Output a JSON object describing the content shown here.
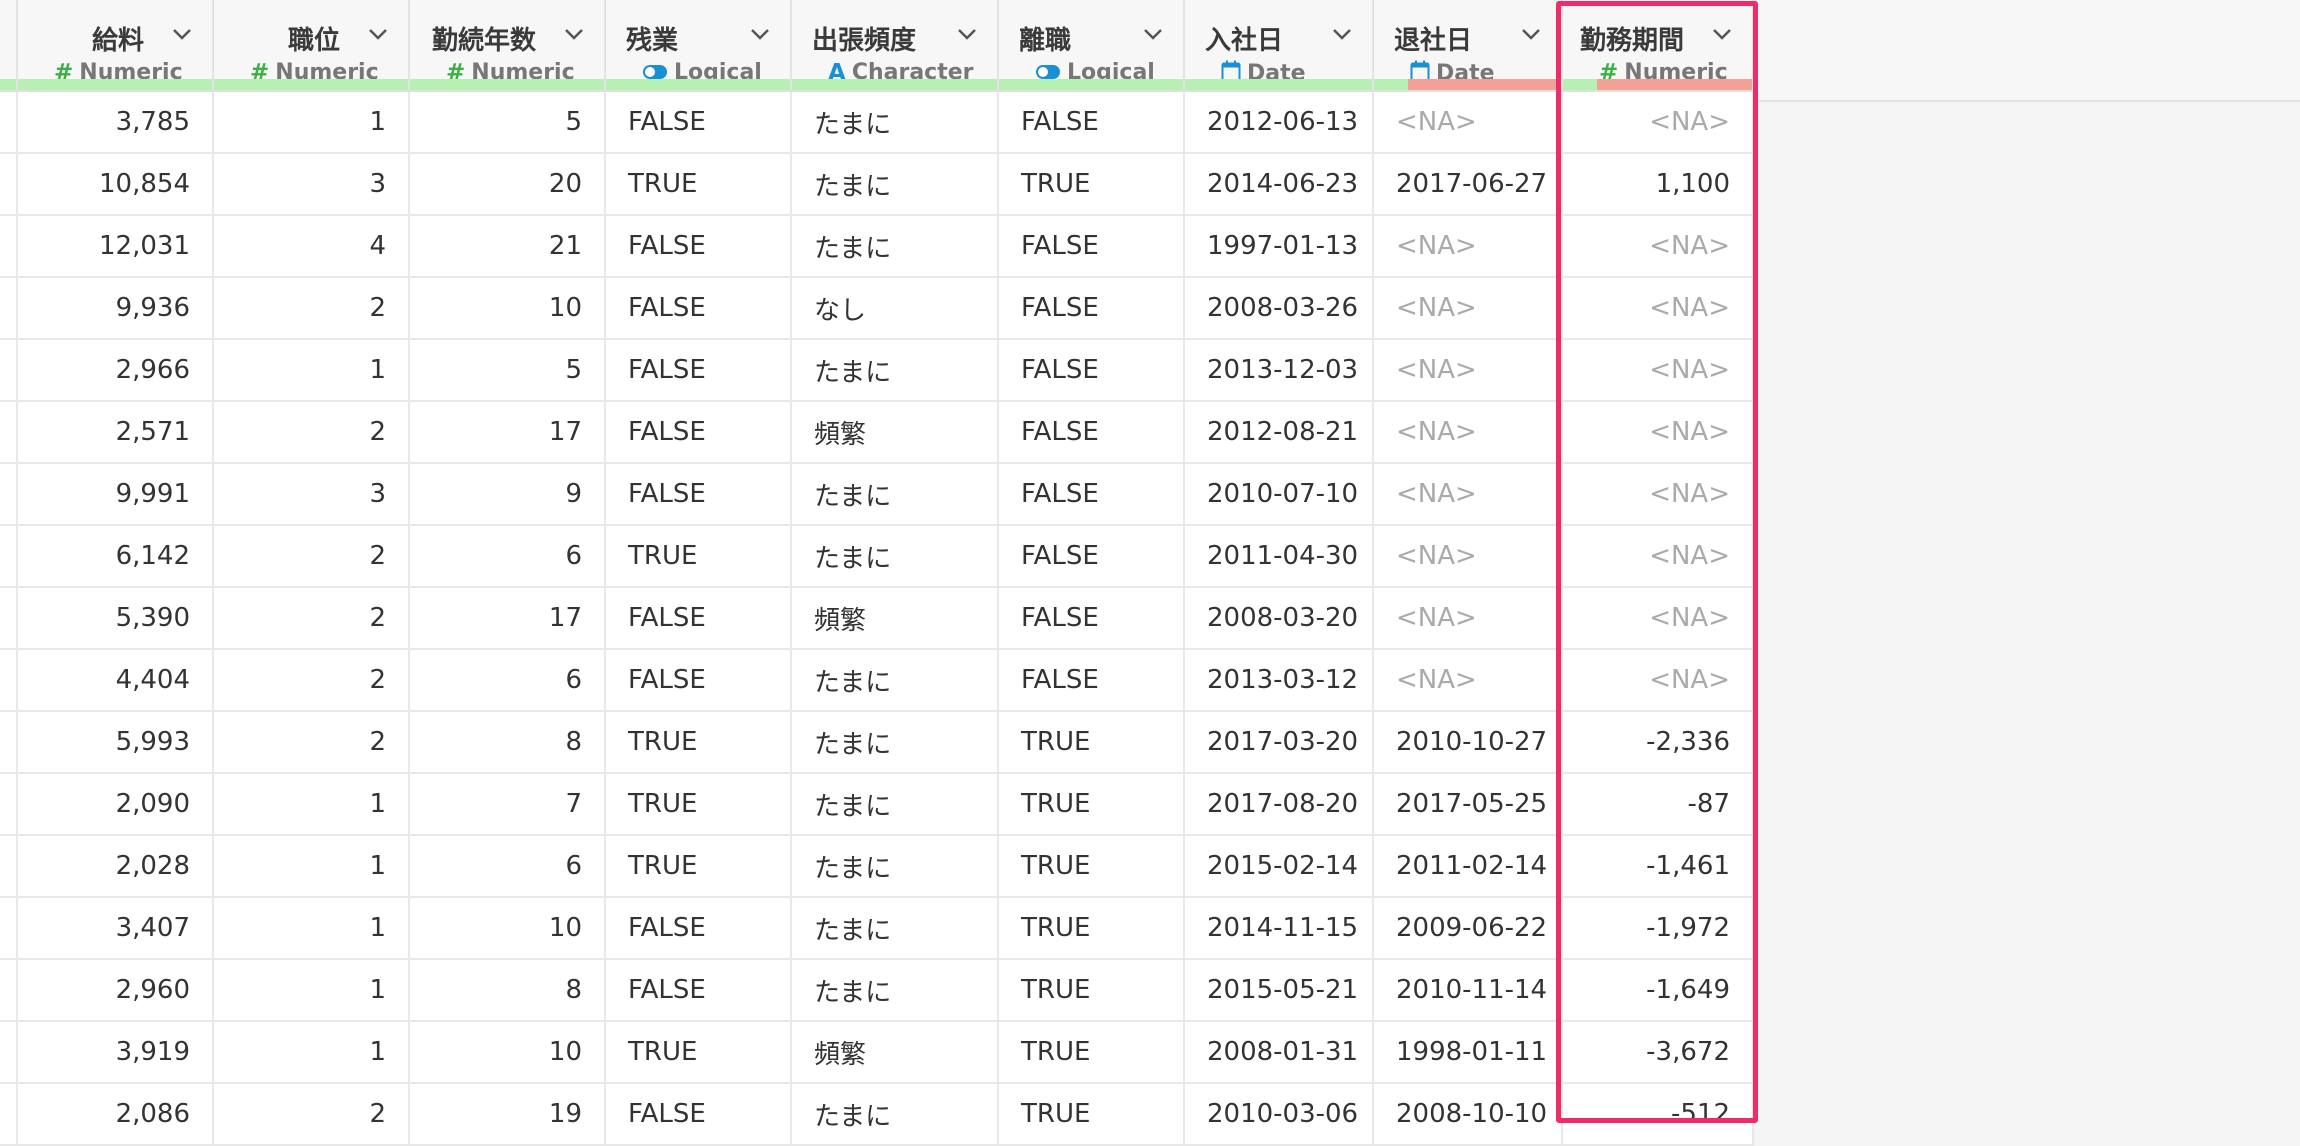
{
  "columns": [
    {
      "name": "給料",
      "type": "Numeric",
      "icon": "hash-icon",
      "align": "num",
      "missing_ratio": 0
    },
    {
      "name": "職位",
      "type": "Numeric",
      "icon": "hash-icon",
      "align": "num",
      "missing_ratio": 0
    },
    {
      "name": "勤続年数",
      "type": "Numeric",
      "icon": "hash-icon",
      "align": "num",
      "missing_ratio": 0
    },
    {
      "name": "残業",
      "type": "Logical",
      "icon": "toggle-icon",
      "align": "txt",
      "missing_ratio": 0
    },
    {
      "name": "出張頻度",
      "type": "Character",
      "icon": "letter-a-icon",
      "align": "txt",
      "missing_ratio": 0
    },
    {
      "name": "離職",
      "type": "Logical",
      "icon": "toggle-icon",
      "align": "txt",
      "missing_ratio": 0
    },
    {
      "name": "入社日",
      "type": "Date",
      "icon": "calendar-icon",
      "align": "txt",
      "missing_ratio": 0
    },
    {
      "name": "退社日",
      "type": "Date",
      "icon": "calendar-icon",
      "align": "txt",
      "missing_ratio": 0.82
    },
    {
      "name": "勤務期間",
      "type": "Numeric",
      "icon": "hash-icon",
      "align": "num",
      "missing_ratio": 0.82
    }
  ],
  "rows": [
    [
      "3,785",
      "1",
      "5",
      "FALSE",
      "たまに",
      "FALSE",
      "2012-06-13",
      "<NA>",
      "<NA>"
    ],
    [
      "10,854",
      "3",
      "20",
      "TRUE",
      "たまに",
      "TRUE",
      "2014-06-23",
      "2017-06-27",
      "1,100"
    ],
    [
      "12,031",
      "4",
      "21",
      "FALSE",
      "たまに",
      "FALSE",
      "1997-01-13",
      "<NA>",
      "<NA>"
    ],
    [
      "9,936",
      "2",
      "10",
      "FALSE",
      "なし",
      "FALSE",
      "2008-03-26",
      "<NA>",
      "<NA>"
    ],
    [
      "2,966",
      "1",
      "5",
      "FALSE",
      "たまに",
      "FALSE",
      "2013-12-03",
      "<NA>",
      "<NA>"
    ],
    [
      "2,571",
      "2",
      "17",
      "FALSE",
      "頻繁",
      "FALSE",
      "2012-08-21",
      "<NA>",
      "<NA>"
    ],
    [
      "9,991",
      "3",
      "9",
      "FALSE",
      "たまに",
      "FALSE",
      "2010-07-10",
      "<NA>",
      "<NA>"
    ],
    [
      "6,142",
      "2",
      "6",
      "TRUE",
      "たまに",
      "FALSE",
      "2011-04-30",
      "<NA>",
      "<NA>"
    ],
    [
      "5,390",
      "2",
      "17",
      "FALSE",
      "頻繁",
      "FALSE",
      "2008-03-20",
      "<NA>",
      "<NA>"
    ],
    [
      "4,404",
      "2",
      "6",
      "FALSE",
      "たまに",
      "FALSE",
      "2013-03-12",
      "<NA>",
      "<NA>"
    ],
    [
      "5,993",
      "2",
      "8",
      "TRUE",
      "たまに",
      "TRUE",
      "2017-03-20",
      "2010-10-27",
      "-2,336"
    ],
    [
      "2,090",
      "1",
      "7",
      "TRUE",
      "たまに",
      "TRUE",
      "2017-08-20",
      "2017-05-25",
      "-87"
    ],
    [
      "2,028",
      "1",
      "6",
      "TRUE",
      "たまに",
      "TRUE",
      "2015-02-14",
      "2011-02-14",
      "-1,461"
    ],
    [
      "3,407",
      "1",
      "10",
      "FALSE",
      "たまに",
      "TRUE",
      "2014-11-15",
      "2009-06-22",
      "-1,972"
    ],
    [
      "2,960",
      "1",
      "8",
      "FALSE",
      "たまに",
      "TRUE",
      "2015-05-21",
      "2010-11-14",
      "-1,649"
    ],
    [
      "3,919",
      "1",
      "10",
      "TRUE",
      "頻繁",
      "TRUE",
      "2008-01-31",
      "1998-01-11",
      "-3,672"
    ],
    [
      "2,086",
      "2",
      "19",
      "FALSE",
      "たまに",
      "TRUE",
      "2010-03-06",
      "2008-10-10",
      "-512"
    ]
  ],
  "colors": {
    "accent_highlight": "#ee2d68",
    "valid_bar": "#b7f0b2",
    "missing_bar": "#f1a196",
    "numeric_icon": "#3cb043",
    "other_icon": "#1a8fd6",
    "na_text": "#aaaaaa"
  }
}
